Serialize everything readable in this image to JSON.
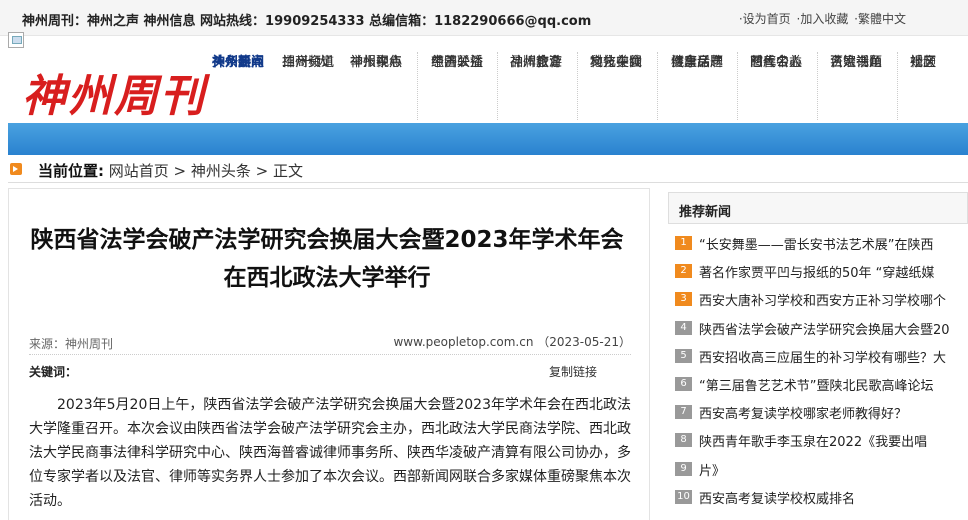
{
  "topbar": {
    "left_text": "神州周刊：神州之声 神州信息 网站热线：19909254333 总编信箱：1182290666@qq.com",
    "links": [
      "·设为首页",
      "·加入收藏",
      "·繁體中文"
    ]
  },
  "logo_text": "神州周刊",
  "nav": {
    "rows": [
      [
        "头条新闻",
        "神州资讯",
        "神州聚焦",
        "慈善公益",
        "神州教育",
        "文化中国",
        "健康话题",
        "时代名人",
        "百姓话题",
        "社区"
      ],
      [
        "神州热点",
        "二 十 大",
        "神州视点",
        "中国关注",
        "神州旅游",
        "地方美食",
        "楼盘房产",
        "图库中心",
        "法治视角",
        "视频"
      ],
      [
        "神州要闻",
        "招商频道",
        "举报中心",
        "经济联播",
        "品牌企业",
        "科技在线",
        "汽车品牌",
        "慈善公益",
        "名家书画",
        "婚庆"
      ]
    ]
  },
  "breadcrumb": {
    "label": "当前位置:",
    "path": "网站首页 > 神州头条 > 正文"
  },
  "article": {
    "title": "陕西省法学会破产法学研究会换届大会暨2023年学术年会在西北政法大学举行",
    "source": "来源：神州周刊",
    "site_date": "www.peopletop.com.cn （2023-05-21）",
    "keywords_label": "关键词：",
    "copy_link": "复制链接",
    "body": "2023年5月20日上午，陕西省法学会破产法学研究会换届大会暨2023年学术年会在西北政法大学隆重召开。本次会议由陕西省法学会破产法学研究会主办，西北政法大学民商法学院、西北政法大学民商事法律科学研究中心、陕西海普睿诚律师事务所、陕西华凌破产清算有限公司协办，多位专家学者以及法官、律师等实务界人士参加了本次会议。西部新闻网联合多家媒体重磅聚焦本次活动。"
  },
  "recommend": {
    "title": "推荐新闻",
    "items": [
      {
        "num": "1",
        "text": "“长安舞墨——雷长安书法艺术展”在陕西"
      },
      {
        "num": "2",
        "text": "著名作家贾平凹与报纸的50年 “穿越纸媒"
      },
      {
        "num": "3",
        "text": "西安大唐补习学校和西安方正补习学校哪个"
      },
      {
        "num": "4",
        "text": "陕西省法学会破产法学研究会换届大会暨20"
      },
      {
        "num": "5",
        "text": "西安招收高三应届生的补习学校有哪些？大"
      },
      {
        "num": "6",
        "text": "“第三届鲁艺艺术节”暨陕北民歌高峰论坛"
      },
      {
        "num": "7",
        "text": "西安高考复读学校哪家老师教得好？"
      },
      {
        "num": "8",
        "text": "陕西青年歌手李玉泉在2022《我要出唱"
      },
      {
        "num": "9",
        "text": "片》"
      },
      {
        "num": "10",
        "text": "西安高考复读学校权威排名"
      }
    ]
  }
}
